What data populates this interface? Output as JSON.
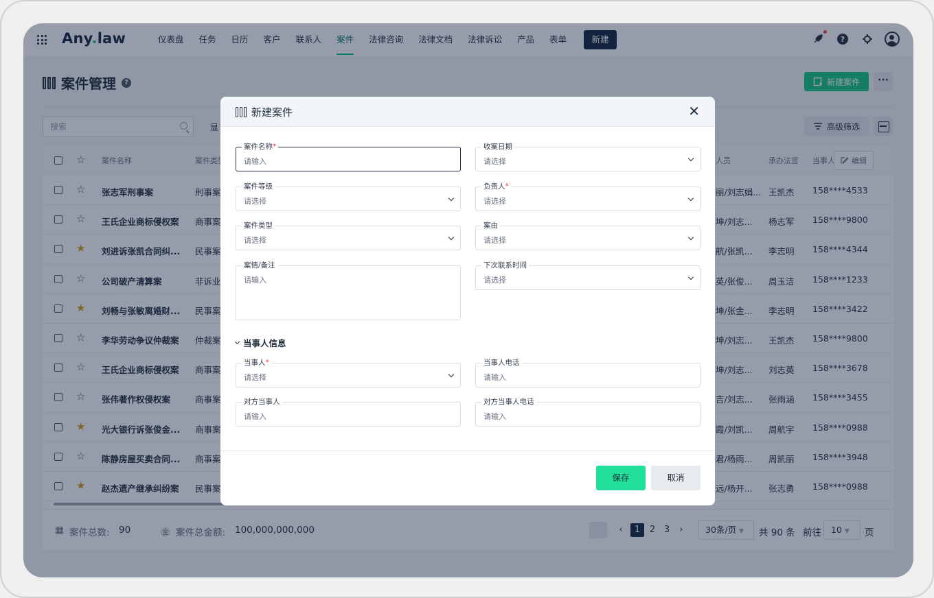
{
  "nav": {
    "logo_a": "Any",
    "logo_dot": ".",
    "logo_b": "law",
    "items": [
      "仪表盘",
      "任务",
      "日历",
      "客户",
      "联系人",
      "案件",
      "法律咨询",
      "法律文档",
      "法律诉讼",
      "产品",
      "表单"
    ],
    "active": "案件",
    "new_label": "新建"
  },
  "page": {
    "title": "案件管理",
    "new_case_label": "新建案件",
    "more_label": "···",
    "search_placeholder": "搜索",
    "show_label": "显",
    "filter_label": "高级筛选"
  },
  "table": {
    "headers": {
      "name": "案件名称",
      "type": "案件类型",
      "staff": "人员",
      "judge": "承办法官",
      "party_phone": "当事人",
      "edit": "编辑"
    },
    "rows": [
      {
        "starred": false,
        "name": "张志军刑事案",
        "type": "刑事案",
        "staff": "丽/刘志娟...",
        "judge": "王凯杰",
        "phone": "158****4533"
      },
      {
        "starred": false,
        "name": "王氏企业商标侵权案",
        "type": "商事案",
        "staff": "坤/刘志...",
        "judge": "杨志军",
        "phone": "158****9800"
      },
      {
        "starred": true,
        "name": "刘进诉张凯合同纠...",
        "type": "民事案",
        "staff": "航/张凯...",
        "judge": "李志明",
        "phone": "158****4344"
      },
      {
        "starred": false,
        "name": "公司破产清算案",
        "type": "非诉业",
        "staff": "英/张俊...",
        "judge": "周玉洁",
        "phone": "158****1233"
      },
      {
        "starred": true,
        "name": "刘畅与张敏离婚财...",
        "type": "民事案",
        "staff": "坤/张金...",
        "judge": "李志明",
        "phone": "158****3422"
      },
      {
        "starred": false,
        "name": "李华劳动争议仲裁案",
        "type": "仲裁案",
        "staff": "坤/刘志...",
        "judge": "王凯杰",
        "phone": "158****9800"
      },
      {
        "starred": false,
        "name": "王氏企业商标侵权案",
        "type": "商事案",
        "staff": "坤/刘志...",
        "judge": "刘志英",
        "phone": "158****3678"
      },
      {
        "starred": false,
        "name": "张伟著作权侵权案",
        "type": "商事案",
        "staff": "吉/刘志...",
        "judge": "张雨涵",
        "phone": "158****3455"
      },
      {
        "starred": true,
        "name": "光大银行诉张俊金...",
        "type": "商事案",
        "staff": "霞/刘凯...",
        "judge": "周航宇",
        "phone": "158****0988"
      },
      {
        "starred": false,
        "name": "陈静房屋买卖合同...",
        "type": "商事案",
        "staff": "君/杨雨...",
        "judge": "周凯丽",
        "phone": "158****3948"
      },
      {
        "starred": true,
        "name": "赵杰遗产继承纠纷案",
        "type": "民事案",
        "staff": "远/杨开...",
        "judge": "张志勇",
        "phone": "158****0988"
      }
    ]
  },
  "footer": {
    "total_label": "案件总数:",
    "total_value": "90",
    "amount_label": "案件总金额:",
    "amount_value": "100,000,000,000",
    "pages": [
      "1",
      "2",
      "3"
    ],
    "current_page": "1",
    "prev": "‹",
    "next": "›",
    "per_page": "30条/页",
    "total_items": "共 90 条",
    "goto_label": "前往",
    "goto_value": "10",
    "page_suffix": "页"
  },
  "modal": {
    "title": "新建案件",
    "close": "✕",
    "fields": {
      "case_name": {
        "label": "案件名称",
        "required": "*",
        "placeholder": "请输入"
      },
      "receive_date": {
        "label": "收案日期",
        "placeholder": "请选择"
      },
      "case_level": {
        "label": "案件等级",
        "placeholder": "请选择"
      },
      "owner": {
        "label": "负责人",
        "required": "*",
        "placeholder": "请选择"
      },
      "case_type": {
        "label": "案件类型",
        "placeholder": "请选择"
      },
      "cause": {
        "label": "案由",
        "placeholder": "请选择"
      },
      "notes": {
        "label": "案情/备注",
        "placeholder": "请输入"
      },
      "next_contact": {
        "label": "下次联系时间",
        "placeholder": "请选择"
      },
      "party": {
        "label": "当事人",
        "required": "*",
        "placeholder": "请选择"
      },
      "party_phone": {
        "label": "当事人电话",
        "placeholder": "请输入"
      },
      "opponent": {
        "label": "对方当事人",
        "placeholder": "请输入"
      },
      "opponent_phone": {
        "label": "对方当事人电话",
        "placeholder": "请输入"
      }
    },
    "section_party": "当事人信息",
    "save": "保存",
    "cancel": "取消"
  },
  "colors": {
    "brand_navy": "#13233f",
    "accent_green": "#16c784",
    "save_green": "#22e09a",
    "star_gold": "#d49a16"
  }
}
